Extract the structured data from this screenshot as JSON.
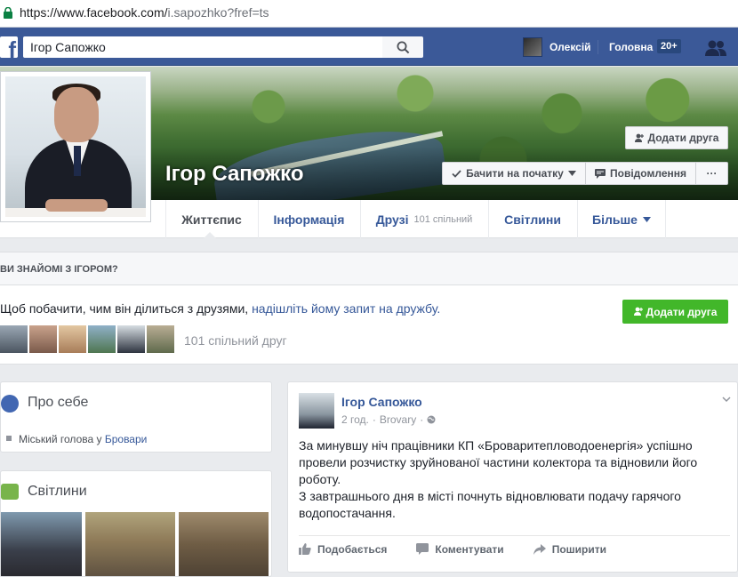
{
  "browser": {
    "url_host": "https://www.facebook.com/",
    "url_path": "i.sapozhko?fref=ts"
  },
  "topbar": {
    "search_value": "Ігор Сапожко",
    "user_name": "Олексій",
    "home_label": "Головна",
    "home_badge": "20+"
  },
  "profile": {
    "name": "Ігор Сапожко",
    "add_friend_label": "Додати друга",
    "follow_label": "Бачити на початку",
    "message_label": "Повідомлення",
    "more_label": "···"
  },
  "tabs": [
    {
      "label": "Життєпис"
    },
    {
      "label": "Інформація"
    },
    {
      "label": "Друзі",
      "sub": "101 спільний"
    },
    {
      "label": "Світлини"
    },
    {
      "label": "Більше"
    }
  ],
  "know": {
    "title": "ВИ ЗНАЙОМІ З ІГОРОМ?",
    "text": "Щоб побачити, чим він ділиться з друзями,",
    "link": "надішліть йому запит на дружбу.",
    "button": "Додати друга",
    "mutual_label": "101 спільний друг"
  },
  "about": {
    "title": "Про себе",
    "line_prefix": "Міський голова у",
    "line_link": "Бровари"
  },
  "photos": {
    "title": "Світлини"
  },
  "post": {
    "author": "Ігор Сапожко",
    "time": "2 год.",
    "separator": "·",
    "place": "Brovary",
    "text1": "За минувшу ніч працівники КП «Броваритепловодоенергія» успішно провели розчистку зруйнованої частини колектора та відновили його роботу.",
    "text2": "З завтрашнього дня в місті почнуть відновлювати подачу гарячого водопостачання.",
    "like": "Подобається",
    "comment": "Коментувати",
    "share": "Поширити"
  },
  "colors": {
    "brand": "#3b5998",
    "link": "#365899",
    "green": "#42b72a"
  }
}
